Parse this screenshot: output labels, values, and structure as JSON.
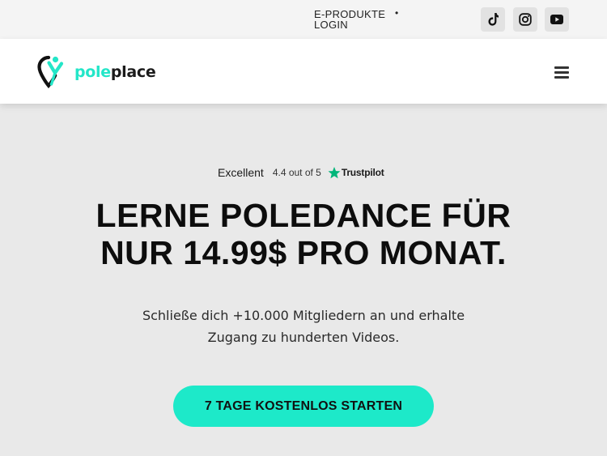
{
  "topbar": {
    "links": [
      "E-PRODUKTE",
      "LOGIN"
    ],
    "separator": "•",
    "social_icons": [
      "tiktok-icon",
      "instagram-icon",
      "youtube-icon"
    ]
  },
  "header": {
    "logo": {
      "part1": "pole",
      "part2": "place"
    },
    "menu_icon": "hamburger-menu-icon"
  },
  "trustpilot": {
    "rating_label": "Excellent",
    "score": "4.4 out of 5",
    "brand": "Trustpilot"
  },
  "hero": {
    "headline_line1": "LERNE POLEDANCE FÜR",
    "headline_line2": "NUR 14.99$ PRO MONAT.",
    "sub_line1": "Schließe dich +10.000 Mitgliedern an und erhalte",
    "sub_line2": "Zugang zu hunderten Videos.",
    "cta_label": "7 TAGE KOSTENLOS STARTEN"
  },
  "colors": {
    "accent": "#1de9c9",
    "background": "#e9e9e9",
    "trustpilot_green": "#00b67a"
  }
}
